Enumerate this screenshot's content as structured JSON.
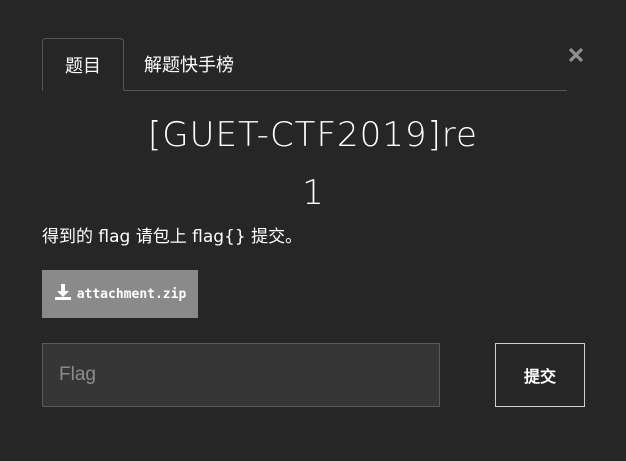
{
  "tabs": [
    {
      "label": "题目",
      "active": true
    },
    {
      "label": "解题快手榜",
      "active": false
    }
  ],
  "close_icon": "close-icon",
  "challenge": {
    "title": "[GUET-CTF2019]re",
    "points": "1",
    "description": "得到的 flag 请包上 flag{} 提交。"
  },
  "attachment": {
    "icon": "download-icon",
    "label": "attachment.zip"
  },
  "flag_input": {
    "value": "",
    "placeholder": "Flag"
  },
  "submit": {
    "label": "提交"
  },
  "colors": {
    "background": "#262626",
    "border": "#555555",
    "attachment_bg": "#8a8a8a",
    "input_bg": "#363636"
  }
}
